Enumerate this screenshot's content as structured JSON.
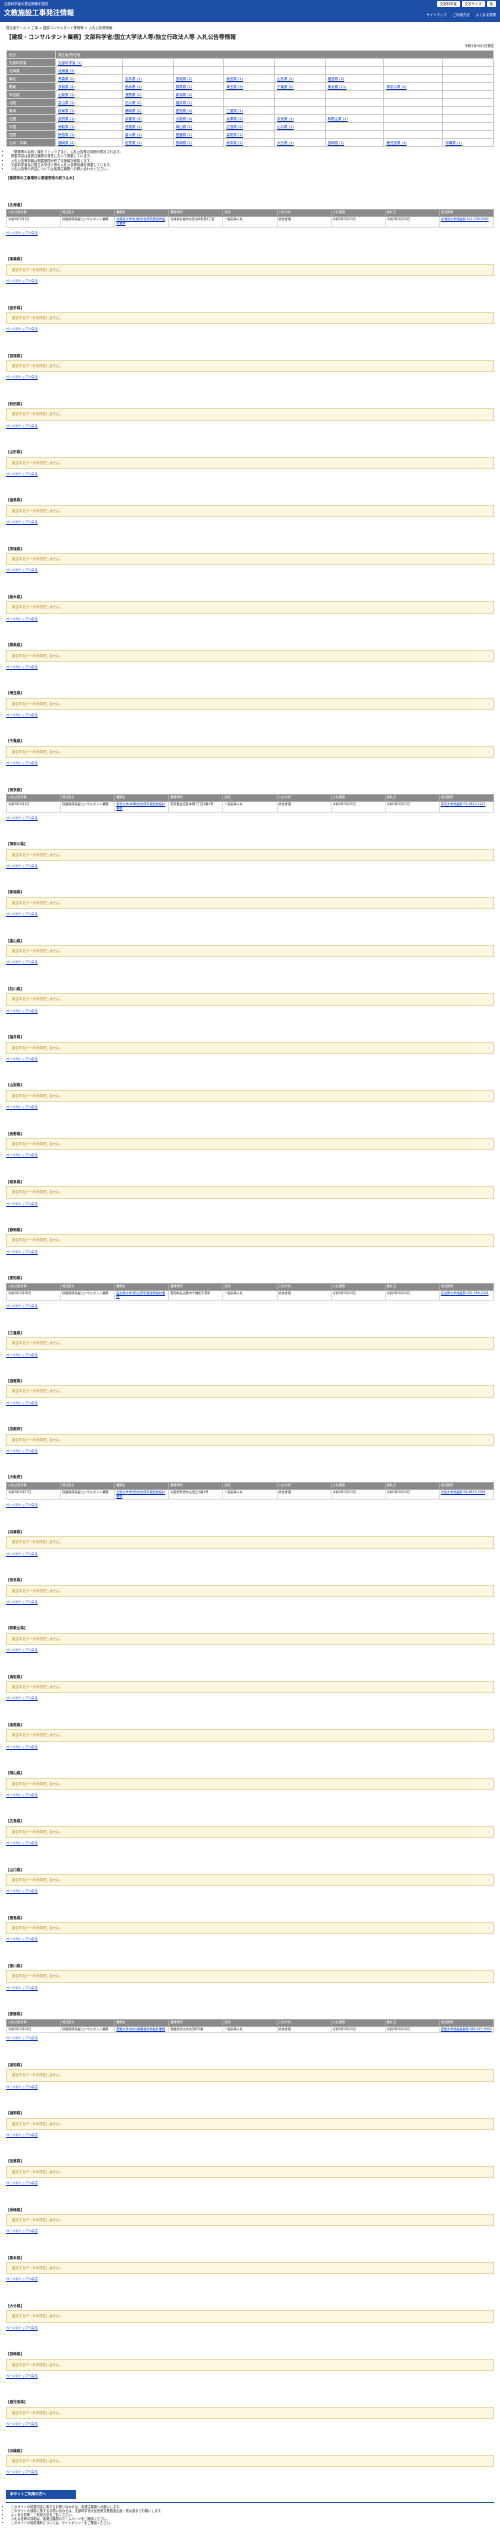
{
  "header": {
    "sub": "文部科学省の発注情報を提供",
    "title": "文教施設工事発注情報",
    "tools": [
      "文部科学省",
      "文字サイズ",
      "色"
    ],
    "nav": [
      "サイトマップ",
      "ご利用方法",
      "よくある質問"
    ]
  },
  "breadcrumb": "発注者ホーム > 工事 > 建設コンサルタント業務等 > 入札公告等情報",
  "page_title": "【建設・コンサルタント業務】文部科学省/国立大学法人等/独立行政法人等 入札公告等情報",
  "date": "令和5年3月1日現在",
  "link_table": {
    "rows": [
      {
        "label": "区分",
        "cells": [
          "発注者/所在地"
        ],
        "head": true
      },
      {
        "label": "文部科学省",
        "cells": [
          "文部科学省 (1)"
        ]
      },
      {
        "label": "北海道",
        "cells": [
          "北海道 (3)"
        ]
      },
      {
        "label": "東北",
        "cells": [
          "青森県 (2)",
          "岩手県 (1)",
          "宮城県 (2)",
          "秋田県 (1)",
          "山形県 (2)",
          "福島県 (2)"
        ]
      },
      {
        "label": "関東",
        "cells": [
          "茨城県 (3)",
          "栃木県 (1)",
          "群馬県 (1)",
          "埼玉県 (3)",
          "千葉県 (2)",
          "東京都 (11)",
          "神奈川県 (2)"
        ]
      },
      {
        "label": "甲信越",
        "cells": [
          "山梨県 (1)",
          "長野県 (2)",
          "新潟県 (2)"
        ]
      },
      {
        "label": "北陸",
        "cells": [
          "富山県 (1)",
          "石川県 (2)",
          "福井県 (1)"
        ]
      },
      {
        "label": "東海",
        "cells": [
          "岐阜県 (1)",
          "静岡県 (2)",
          "愛知県 (4)",
          "三重県 (1)"
        ]
      },
      {
        "label": "近畿",
        "cells": [
          "滋賀県 (1)",
          "京都府 (3)",
          "大阪府 (4)",
          "兵庫県 (2)",
          "奈良県 (1)",
          "和歌山県 (1)"
        ]
      },
      {
        "label": "中国",
        "cells": [
          "鳥取県 (1)",
          "島根県 (1)",
          "岡山県 (1)",
          "広島県 (2)",
          "山口県 (1)"
        ]
      },
      {
        "label": "四国",
        "cells": [
          "徳島県 (1)",
          "香川県 (1)",
          "愛媛県 (1)",
          "高知県 (1)"
        ]
      },
      {
        "label": "九州・沖縄",
        "cells": [
          "福岡県 (4)",
          "佐賀県 (1)",
          "長崎県 (1)",
          "熊本県 (1)",
          "大分県 (1)",
          "宮崎県 (1)",
          "鹿児島県 (1)",
          "沖縄県 (1)"
        ]
      }
    ]
  },
  "notes": [
    "「業務等の名称」欄をクリックすると、入札公告等の詳細が表示されます。",
    "掲載内容は各発注機関の責任において掲載しています。",
    "入札公告等情報は掲載期間が終了次第順次削除します。",
    "文部科学省及び国立大学法人等の入札公告等情報を掲載しています。",
    "入札公告等の内容については各発注機関へお問い合わせください。"
  ],
  "lead": "【業務等の工事場所に都道府県の絞り込み】",
  "empty_message": "該当するデータが存在しません。",
  "top_link": "ページのトップへ戻る",
  "res_headers": [
    "入札公告日等",
    "発注区分",
    "業務名",
    "業務場所",
    "担当",
    "入札方式",
    "入札期限",
    "開札日",
    "担当部局"
  ],
  "sections": [
    {
      "name": "【北海道】",
      "rows": [
        [
          "令和5年3月1日",
          "建築関係建設コンサルタント業務",
          "北海道大学(札幌)総合研究棟改修設計業務",
          "北海道札幌市北区北8条西5丁目",
          "一般競争入札",
          "総合評価",
          "令和5年3月13日",
          "令和5年3月24日",
          "北海道大学施設部 011-706-2000"
        ]
      ]
    },
    {
      "name": "【青森県】"
    },
    {
      "name": "【岩手県】"
    },
    {
      "name": "【宮城県】"
    },
    {
      "name": "【秋田県】"
    },
    {
      "name": "【山形県】"
    },
    {
      "name": "【福島県】"
    },
    {
      "name": "【茨城県】"
    },
    {
      "name": "【栃木県】"
    },
    {
      "name": "【群馬県】"
    },
    {
      "name": "【埼玉県】"
    },
    {
      "name": "【千葉県】"
    },
    {
      "name": "【東京都】",
      "rows": [
        [
          "令和5年3月1日",
          "建築関係建設コンサルタント業務",
          "東京大学(本郷)総合研究棟改修設計業務",
          "東京都文京区本郷7丁目3番1号",
          "一般競争入札",
          "総合評価",
          "令和5年3月15日",
          "令和5年3月27日",
          "東京大学施設部 03-3812-2111"
        ]
      ]
    },
    {
      "name": "【神奈川県】"
    },
    {
      "name": "【新潟県】"
    },
    {
      "name": "【富山県】"
    },
    {
      "name": "【石川県】"
    },
    {
      "name": "【福井県】"
    },
    {
      "name": "【山梨県】"
    },
    {
      "name": "【長野県】"
    },
    {
      "name": "【岐阜県】"
    },
    {
      "name": "【静岡県】"
    },
    {
      "name": "【愛知県】",
      "rows": [
        [
          "令和5年2月28日",
          "建築関係建設コンサルタント業務",
          "名古屋大学(東山)研究棟改修設計業務",
          "愛知県名古屋市千種区不老町",
          "一般競争入札",
          "総合評価",
          "令和5年3月14日",
          "令和5年3月24日",
          "名古屋大学施設部 052-789-2024"
        ]
      ]
    },
    {
      "name": "【三重県】"
    },
    {
      "name": "【滋賀県】"
    },
    {
      "name": "【京都府】"
    },
    {
      "name": "【大阪府】",
      "rows": [
        [
          "令和5年2月27日",
          "建築関係建設コンサルタント業務",
          "大阪大学(吹田)総合研究棟改修設計業務",
          "大阪府吹田市山田丘1番1号",
          "一般競争入札",
          "総合評価",
          "令和5年3月13日",
          "令和5年3月23日",
          "大阪大学施設部 06-6879-7063"
        ]
      ]
    },
    {
      "name": "【兵庫県】"
    },
    {
      "name": "【奈良県】"
    },
    {
      "name": "【和歌山県】"
    },
    {
      "name": "【鳥取県】"
    },
    {
      "name": "【島根県】"
    },
    {
      "name": "【岡山県】"
    },
    {
      "name": "【広島県】"
    },
    {
      "name": "【山口県】"
    },
    {
      "name": "【徳島県】"
    },
    {
      "name": "【香川県】"
    },
    {
      "name": "【愛媛県】",
      "rows": [
        [
          "令和5年2月24日",
          "建築関係建設コンサルタント業務",
          "愛媛大学(城北)講義棟改修設計業務",
          "愛媛県松山市文京町3番",
          "一般競争入札",
          "総合評価",
          "令和5年3月10日",
          "令和5年3月20日",
          "愛媛大学施設基盤部 089-927-9000"
        ]
      ]
    },
    {
      "name": "【高知県】"
    },
    {
      "name": "【福岡県】"
    },
    {
      "name": "【佐賀県】"
    },
    {
      "name": "【長崎県】"
    },
    {
      "name": "【熊本県】"
    },
    {
      "name": "【大分県】"
    },
    {
      "name": "【宮崎県】"
    },
    {
      "name": "【鹿児島県】"
    },
    {
      "name": "【沖縄県】"
    }
  ],
  "footer": {
    "bar": "本サイトご利用の方へ",
    "items": [
      "このサイトの掲載内容に関するお問い合わせは、各発注機関へお願いします。",
      "このサイトの運用に関するお問い合わせは、文部科学省大臣官房文教施設企画・防災部までお願いします。",
      "よくある質問・ご利用方法をご覧ください。",
      "入札公告等の詳細は、各発注機関のホームページをご確認ください。",
      "このサイトの利用規約については、サイトポリシーをご確認ください。"
    ]
  }
}
